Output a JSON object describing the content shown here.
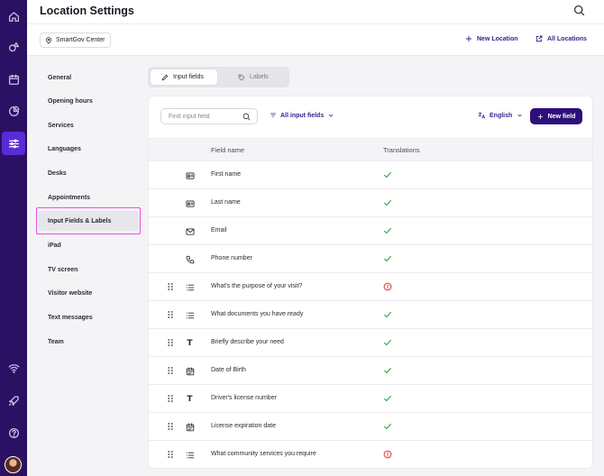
{
  "header": {
    "title": "Location Settings"
  },
  "subheader": {
    "location_chip": "SmartGov Center",
    "new_location": "New Location",
    "all_locations": "All Locations"
  },
  "settings_nav": {
    "items": [
      {
        "label": "General"
      },
      {
        "label": "Opening hours"
      },
      {
        "label": "Services"
      },
      {
        "label": "Languages"
      },
      {
        "label": "Desks"
      },
      {
        "label": "Appointments"
      },
      {
        "label": "Input Fields & Labels",
        "active": true
      },
      {
        "label": "iPad"
      },
      {
        "label": "TV screen"
      },
      {
        "label": "Visitor website"
      },
      {
        "label": "Text messages"
      },
      {
        "label": "Team"
      }
    ]
  },
  "tabs": [
    {
      "label": "Input fields",
      "icon": "pencil-icon",
      "active": true
    },
    {
      "label": "Labels",
      "icon": "tag-icon",
      "active": false
    }
  ],
  "toolbar": {
    "search_placeholder": "Find input field",
    "filter_label": "All input fields",
    "language_label": "English",
    "new_field_label": "New field"
  },
  "table": {
    "col_field_name": "Field name",
    "col_translations": "Translations",
    "rows": [
      {
        "name": "First name",
        "icon": "id-card-icon",
        "draggable": false,
        "status": "complete"
      },
      {
        "name": "Last name",
        "icon": "id-card-icon",
        "draggable": false,
        "status": "complete"
      },
      {
        "name": "Email",
        "icon": "mail-icon",
        "draggable": false,
        "status": "complete"
      },
      {
        "name": "Phone number",
        "icon": "phone-icon",
        "draggable": false,
        "status": "complete"
      },
      {
        "name": "What's the purpose of your visit?",
        "icon": "list-icon",
        "draggable": true,
        "status": "missing"
      },
      {
        "name": "What documents you have ready",
        "icon": "list-icon",
        "draggable": true,
        "status": "complete"
      },
      {
        "name": "Briefly describe your need",
        "icon": "text-icon",
        "draggable": true,
        "status": "complete"
      },
      {
        "name": "Date of Birth",
        "icon": "calendar-icon",
        "draggable": true,
        "status": "complete"
      },
      {
        "name": "Driver's license number",
        "icon": "text-icon",
        "draggable": true,
        "status": "complete"
      },
      {
        "name": "License expiration date",
        "icon": "calendar-icon",
        "draggable": true,
        "status": "complete"
      },
      {
        "name": "What community services you require",
        "icon": "list-icon",
        "draggable": true,
        "status": "missing"
      }
    ]
  },
  "colors": {
    "rail": "#2b1163",
    "accent": "#3a1d8a",
    "check": "#1f9a3c",
    "warning": "#d63a3a",
    "highlight": "#e64fe0"
  }
}
